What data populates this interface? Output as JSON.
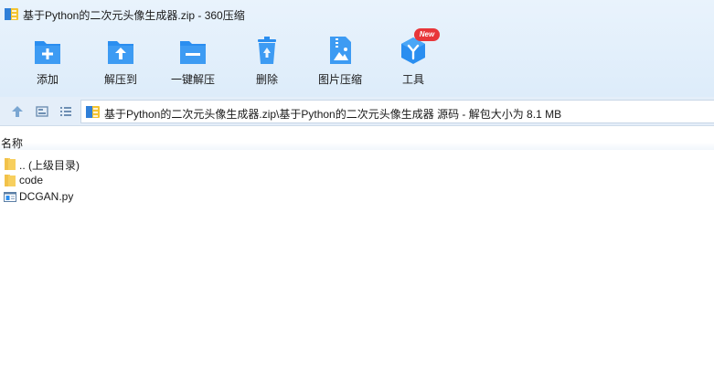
{
  "window": {
    "title": "基于Python的二次元头像生成器.zip - 360压缩"
  },
  "toolbar": {
    "add_label": "添加",
    "extract_label": "解压到",
    "oneclick_label": "一键解压",
    "delete_label": "删除",
    "image_compress_label": "图片压缩",
    "tools_label": "工具",
    "tools_badge": "New"
  },
  "address": {
    "path": "基于Python的二次元头像生成器.zip\\基于Python的二次元头像生成器 源码 - 解包大小为 8.1 MB"
  },
  "list": {
    "columns": [
      "名称"
    ],
    "items": [
      {
        "name": ".. (上级目录)",
        "type": "parent-folder"
      },
      {
        "name": "code",
        "type": "folder"
      },
      {
        "name": "DCGAN.py",
        "type": "python-file"
      }
    ]
  },
  "colors": {
    "accent": "#2a8ef0",
    "badge": "#e8363a",
    "folder": "#f7cf5e"
  }
}
